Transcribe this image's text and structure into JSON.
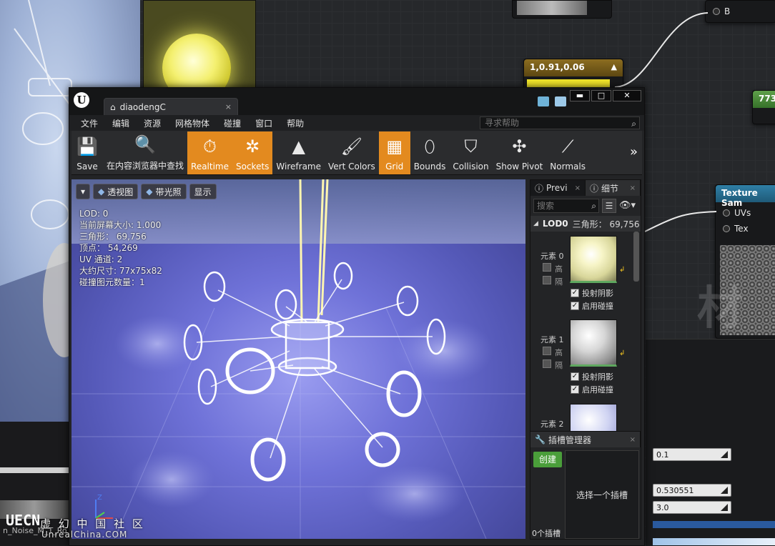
{
  "background": {
    "color_node": {
      "title": "1,0.91,0.06",
      "color": "#f2e62a"
    },
    "node_b_pin": "B",
    "node_773": "773",
    "texture_node": {
      "title": "Texture Sam",
      "pins": [
        "UVs",
        "Tex"
      ]
    },
    "material_watermark": "材质",
    "props": {
      "value_1": "0.1",
      "value_2": "0.530551",
      "value_3": "3.0"
    },
    "left_label": "n_Noise_M_T_Ro"
  },
  "window": {
    "tab_title": "diaodengC",
    "tab_close": "×",
    "buttons": {
      "minimize": "▬",
      "maximize": "□",
      "close": "✕"
    }
  },
  "menu": [
    "文件",
    "编辑",
    "资源",
    "网格物体",
    "碰撞",
    "窗口",
    "帮助"
  ],
  "help_search": {
    "placeholder": "寻求帮助"
  },
  "toolbar": [
    {
      "label": "Save",
      "icon": "save-icon",
      "glyph": "💾",
      "active": false
    },
    {
      "label": "在内容浏览器中查找",
      "icon": "magnifier-icon",
      "glyph": "🔍",
      "active": false
    },
    {
      "label": "Realtime",
      "icon": "stopwatch-icon",
      "glyph": "⏱",
      "active": true
    },
    {
      "label": "Sockets",
      "icon": "socket-icon",
      "glyph": "✲",
      "active": true
    },
    {
      "label": "Wireframe",
      "icon": "wireframe-icon",
      "glyph": "▲",
      "active": false
    },
    {
      "label": "Vert Colors",
      "icon": "paintbrush-icon",
      "glyph": "🖌",
      "active": false
    },
    {
      "label": "Grid",
      "icon": "grid-icon",
      "glyph": "▦",
      "active": true
    },
    {
      "label": "Bounds",
      "icon": "bounds-icon",
      "glyph": "⬯",
      "active": false
    },
    {
      "label": "Collision",
      "icon": "collision-icon",
      "glyph": "⛉",
      "active": false
    },
    {
      "label": "Show Pivot",
      "icon": "pivot-icon",
      "glyph": "✣",
      "active": false
    },
    {
      "label": "Normals",
      "icon": "normals-icon",
      "glyph": "⟋",
      "active": false
    }
  ],
  "toolbar_more": "»",
  "viewport": {
    "menu_arrow": "▾",
    "perspective": "透视图",
    "lit": "带光照",
    "show": "显示",
    "stats": [
      "LOD: 0",
      "当前屏幕大小: 1.000",
      "三角形： 69,756",
      "顶点： 54,269",
      "UV 通道: 2",
      "大约尺寸: 77x75x82",
      "碰撞图元数量：1"
    ],
    "axis_z": "Z"
  },
  "details": {
    "tabs": [
      {
        "label": "Previ",
        "x": "×"
      },
      {
        "label": "细节",
        "x": "×"
      }
    ],
    "search_placeholder": "搜索",
    "lod_label": "LOD0",
    "lod_tris": "三角形： 69,756",
    "elements": [
      {
        "label": "元素 0",
        "opt1": "高",
        "opt2": "隔",
        "shadow": "投射阴影",
        "collision": "启用碰撞"
      },
      {
        "label": "元素 1",
        "opt1": "高",
        "opt2": "隔",
        "shadow": "投射阴影",
        "collision": "启用碰撞"
      },
      {
        "label": "元素 2"
      }
    ]
  },
  "sockets": {
    "title": "插槽管理器",
    "close": "×",
    "create": "创建",
    "empty": "选择一个插槽",
    "count": "0个插槽"
  },
  "watermark": {
    "logo": "UECN",
    "line1": "虚 幻 中 国 社 区",
    "line2": "UnrealChina.COM"
  }
}
